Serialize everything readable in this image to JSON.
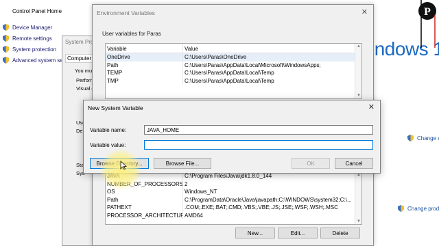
{
  "control_panel": {
    "home": "Control Panel Home",
    "links": [
      "Device Manager",
      "Remote settings",
      "System protection",
      "Advanced system se"
    ],
    "windows_text": "indows 1",
    "change_settings": "Change se",
    "change_product": "Change produ"
  },
  "system_properties": {
    "title": "System Pro",
    "tab": "Computer N",
    "texts": [
      "You mus",
      "Perform",
      "Visual e",
      "User",
      "Des",
      "Star",
      "Sys"
    ]
  },
  "env_vars": {
    "title": "Environment Variables",
    "user_group": "User variables for Paras",
    "columns": [
      "Variable",
      "Value"
    ],
    "user_rows": [
      {
        "var": "OneDrive",
        "val": "C:\\Users\\Paras\\OneDrive"
      },
      {
        "var": "Path",
        "val": "C:\\Users\\Paras\\AppData\\Local\\Microsoft\\WindowsApps;"
      },
      {
        "var": "TEMP",
        "val": "C:\\Users\\Paras\\AppData\\Local\\Temp"
      },
      {
        "var": "TMP",
        "val": "C:\\Users\\Paras\\AppData\\Local\\Temp"
      }
    ],
    "system_rows": [
      {
        "var": "JAVA",
        "val": "C:\\Program Files\\Java\\jdk1.8.0_144"
      },
      {
        "var": "NUMBER_OF_PROCESSORS",
        "val": "2"
      },
      {
        "var": "OS",
        "val": "Windows_NT"
      },
      {
        "var": "Path",
        "val": "C:\\ProgramData\\Oracle\\Java\\javapath;C:\\WINDOWS\\system32;C:\\..."
      },
      {
        "var": "PATHEXT",
        "val": ".COM;.EXE;.BAT;.CMD;.VBS;.VBE;.JS;.JSE;.WSF;.WSH;.MSC"
      },
      {
        "var": "PROCESSOR_ARCHITECTURE",
        "val": "AMD64"
      }
    ],
    "new_label": "New...",
    "edit_label": "Edit...",
    "delete_label": "Delete"
  },
  "new_var": {
    "title": "New System Variable",
    "name_label": "Variable name:",
    "name_value": "JAVA_HOME",
    "value_label": "Variable value:",
    "value_value": "",
    "browse_dir_label": "Browse Directory...",
    "browse_file_label": "Browse File...",
    "ok_label": "OK",
    "cancel_label": "Cancel"
  },
  "colors": {
    "accent": "#0078d7",
    "link": "#1a4fa0",
    "highlight": "#fff078"
  }
}
